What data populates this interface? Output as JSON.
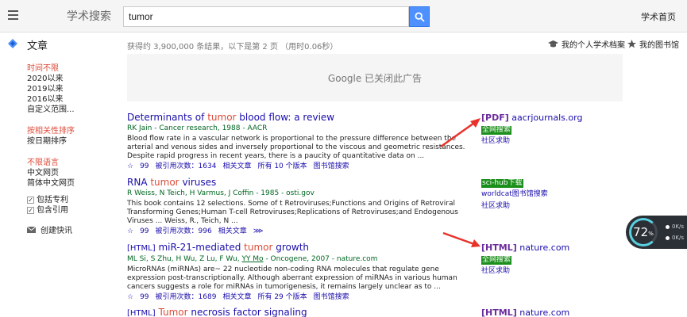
{
  "header": {
    "logo": "学术搜索",
    "search_value": "tumor",
    "home_link": "学术首页"
  },
  "subheader": {
    "section_label": "文章",
    "stats": "获得约 3,900,000 条结果，以下是第 2 页 （用时0.06秒）",
    "profile_link": "我的个人学术档案",
    "library_link": "我的图书馆"
  },
  "sidebar": {
    "time_filters": [
      "时间不限",
      "2020以来",
      "2019以来",
      "2016以来",
      "自定义范围..."
    ],
    "sort_options": [
      "按相关性排序",
      "按日期排序"
    ],
    "language_options": [
      "不限语言",
      "中文网页",
      "简体中文网页"
    ],
    "checkboxes": [
      "包括专利",
      "包含引用"
    ],
    "alert": "创建快讯"
  },
  "ad": {
    "text": "Google 已关闭此广告"
  },
  "results": [
    {
      "tag": "",
      "title_pre": "Determinants of ",
      "title_hl": "tumor",
      "title_post": " blood flow: a review",
      "authors": "RK Jain - Cancer research, 1988 - AACR",
      "snippet": "Blood flow rate in a vascular network is proportional to the pressure difference between the arterial and venous sides and inversely proportional to the viscous and geometric resistances. Despite rapid progress in recent years, there is a paucity of quantitative data on ...",
      "cited": "被引用次数：1634",
      "related": "相关文章",
      "versions": "所有 10 个版本",
      "library": "图书馆搜索",
      "side": {
        "pdf_tag": "[PDF]",
        "source": "aacrjournals.org",
        "green": "全网搜索",
        "help": "社区求助"
      }
    },
    {
      "tag": "",
      "title_pre": "RNA ",
      "title_hl": "tumor",
      "title_post": " viruses",
      "authors": "R Weiss, N Teich, H Varmus, J Coffin - 1985 - osti.gov",
      "snippet": "This book contains 12 selections. Some of t Retroviruses;Functions and Origins of Retroviral Transforming Genes;Human T-cell Retroviruses;Replications of Retroviruses;and Endogenous Viruses ... Weiss, R., Teich, N ...",
      "cited": "被引用次数：996",
      "related": "相关文章",
      "versions": "",
      "library": "",
      "side": {
        "pdf_tag": "",
        "source": "",
        "green": "sci-hub下载",
        "help": "worldcat图书馆搜索",
        "help2": "社区求助"
      }
    },
    {
      "tag": "[HTML]",
      "title_pre": " miR-21-mediated ",
      "title_hl": "tumor",
      "title_post": " growth",
      "authors_pre": "ML Si, S Zhu, H Wu, Z Lu, F Wu, ",
      "authors_u": "YY Mo",
      "authors_post": " - Oncogene, 2007 - nature.com",
      "snippet": "MicroRNAs (miRNAs) are~ 22 nucleotide non-coding RNA molecules that regulate gene expression post-transcriptionally. Although aberrant expression of miRNAs in various human cancers suggests a role for miRNAs in tumorigenesis, it remains largely unclear as to ...",
      "cited": "被引用次数：1689",
      "related": "相关文章",
      "versions": "所有 29 个版本",
      "library": "图书馆搜索",
      "side": {
        "pdf_tag": "[HTML]",
        "source": "nature.com",
        "green": "全网搜索",
        "help": "社区求助"
      }
    },
    {
      "tag": "[HTML]",
      "title_hl": "Tumor",
      "title_post": " necrosis factor signaling",
      "side": {
        "pdf_tag": "[HTML]",
        "source": "nature.com"
      }
    }
  ],
  "widget": {
    "percent": "72",
    "unit": "%",
    "up": "0K/s",
    "down": "0K/s"
  },
  "colors": {
    "accent_blue": "#4d90fe",
    "highlight_red": "#dd4b39",
    "link_blue": "#1a0dab",
    "green_badge": "#1b8f1b",
    "arrow_red": "#e8322a"
  }
}
